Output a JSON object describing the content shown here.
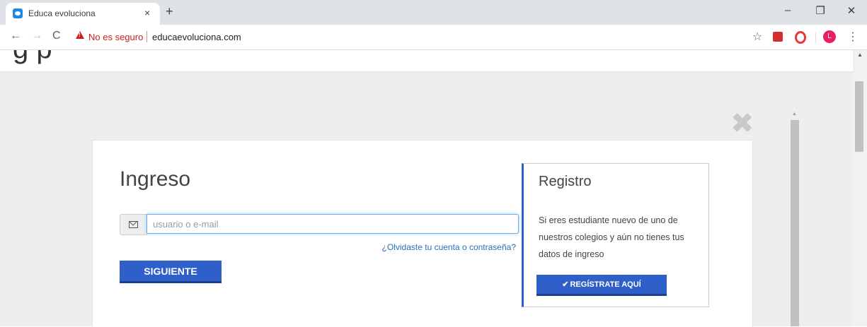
{
  "browser": {
    "tab_title": "Educa evoluciona",
    "tab_close": "×",
    "new_tab": "+",
    "back": "←",
    "forward": "→",
    "reload": "C",
    "security_label": "No es seguro",
    "url": "educaevoluciona.com",
    "bookmark_star": "☆",
    "profile_initial": "L",
    "menu": "⋮",
    "minimize": "–",
    "restore": "❐",
    "close": "✕"
  },
  "page": {
    "heading_clipped": "g p"
  },
  "modal": {
    "close_symbol": "✖",
    "login": {
      "title": "Ingreso",
      "input_placeholder": "usuario o e-mail",
      "forgot_link": "¿Olvidaste tu cuenta o contraseña?",
      "submit_label": "SIGUIENTE"
    },
    "register": {
      "title": "Registro",
      "text": "Si eres estudiante nuevo de uno de nuestros colegios y aún no tienes tus datos de ingreso",
      "check_symbol": "✔",
      "button_label": "REGÍSTRATE AQUÍ"
    }
  },
  "colors": {
    "primary_button": "#2f5fc9",
    "link": "#2a6ebb",
    "warning": "#c5221f",
    "overlay": "#eeeeee"
  },
  "icons": [
    "app-favicon",
    "warning-icon",
    "star-icon",
    "pdf-extension-icon",
    "opera-extension-icon",
    "mail-icon",
    "check-icon",
    "close-icon"
  ]
}
